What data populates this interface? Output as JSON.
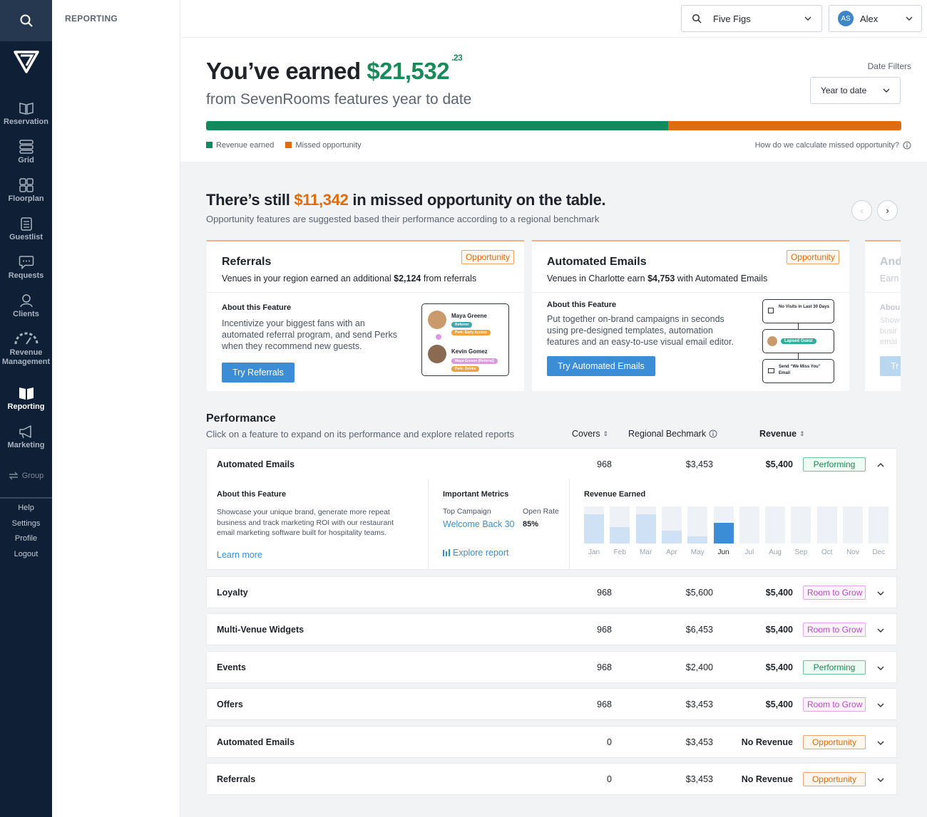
{
  "sidebar": {
    "items": [
      {
        "label": "Reservation",
        "icon": "book-open-icon"
      },
      {
        "label": "Grid",
        "icon": "grid-icon"
      },
      {
        "label": "Floorplan",
        "icon": "floorplan-icon"
      },
      {
        "label": "Guestlist",
        "icon": "clipboard-icon"
      },
      {
        "label": "Requests",
        "icon": "chat-icon"
      },
      {
        "label": "Clients",
        "icon": "user-icon"
      },
      {
        "label": "Revenue Management",
        "icon": "gauge-icon"
      },
      {
        "label": "Reporting",
        "icon": "book-icon"
      },
      {
        "label": "Marketing",
        "icon": "megaphone-icon"
      }
    ],
    "group_label": "Group",
    "bottom_links": [
      "Help",
      "Settings",
      "Profile",
      "Logout"
    ]
  },
  "subnav": {
    "title": "REPORTING"
  },
  "topbar": {
    "venue": "Five Figs",
    "user_initials": "AS",
    "user_name": "Alex"
  },
  "hero": {
    "title_prefix": "You’ve earned ",
    "amount": "$21,532",
    "cents": ".23",
    "subtitle": "from SevenRooms features year to date",
    "date_filters_label": "Date Filters",
    "date_filter_value": "Year to date",
    "earned_fraction": 0.665,
    "legend_earned": "Revenue earned",
    "legend_missed": "Missed opportunity",
    "calc_link": "How do we calculate missed opportunity?"
  },
  "colors": {
    "earned": "#108a5e",
    "missed": "#e06c0e",
    "accent_blue": "#3b8ed6",
    "sidebar_bg": "#0f1f35"
  },
  "opportunity": {
    "title_prefix": "There’s still ",
    "amount": "$11,342",
    "title_suffix": " in missed opportunity on the table.",
    "subtitle": "Opportunity features are suggested based their performance according to a regional benchmark",
    "cards": [
      {
        "title": "Referrals",
        "badge": "Opportunity",
        "desc_prefix": "Venues in your region earned an additional ",
        "desc_amount": "$2,124",
        "desc_suffix": " from referrals",
        "about_label": "About this Feature",
        "about_text": "Incentivize your biggest fans with an automated referral program, and send Perks when they recommend new guests.",
        "button": "Try Referrals",
        "mock": {
          "person1": "Maya Greene",
          "person1_tags": [
            "Referrer",
            "Perk: Early Access"
          ],
          "person2": "Kevin Gomez",
          "person2_tags": [
            "Maya Greene (Referral)",
            "Perk: Drinks"
          ]
        }
      },
      {
        "title": "Automated Emails",
        "badge": "Opportunity",
        "desc_prefix": "Venues in Charlotte earn ",
        "desc_amount": "$4,753",
        "desc_suffix": " with Automated Emails",
        "about_label": "About this Feature",
        "about_text": "Put together on-brand campaigns in seconds using pre-designed templates, automation features and an easy-to-use visual email editor.",
        "button": "Try Automated Emails",
        "mock": {
          "step1": "No Visits in Last 30 Days",
          "step2": "Lapsed Guest",
          "step3": "Send “We Miss You” Email"
        }
      },
      {
        "title": "And",
        "subtitle": "Earn",
        "about_label": "Abou",
        "about_lines": [
          "Show",
          "busir",
          "emai"
        ],
        "button": "Tr"
      }
    ]
  },
  "performance": {
    "title": "Performance",
    "subtitle": "Click on a feature to expand on its performance and explore related reports",
    "columns": {
      "covers": "Covers",
      "benchmark": "Regional Bechmark",
      "revenue": "Revenue"
    },
    "expanded": {
      "about_label": "About this Feature",
      "about_text": "Showcase your unique brand, generate more repeat business and track marketing ROI with our restaurant email marketing software built for hospitality teams.",
      "learn_more": "Learn more",
      "metrics_label": "Important Metrics",
      "top_campaign_label": "Top Campaign",
      "top_campaign_value": "Welcome Back 30",
      "open_rate_label": "Open Rate",
      "open_rate_value": "85%",
      "explore": "Explore report",
      "revenue_label": "Revenue Earned",
      "months": [
        "Jan",
        "Feb",
        "Mar",
        "Apr",
        "May",
        "Jun",
        "Jul",
        "Aug",
        "Sep",
        "Oct",
        "Nov",
        "Dec"
      ],
      "current_month_index": 5,
      "month_fill_fraction": [
        0.78,
        0.44,
        0.78,
        0.35,
        0.19,
        0.56,
        0,
        0,
        0,
        0,
        0,
        0
      ]
    },
    "rows": [
      {
        "name": "Automated Emails",
        "covers": "968",
        "benchmark": "$3,453",
        "revenue": "$5,400",
        "status": "Performing",
        "status_type": "perf",
        "expanded": true
      },
      {
        "name": "Loyalty",
        "covers": "968",
        "benchmark": "$5,600",
        "revenue": "$5,400",
        "status": "Room to Grow",
        "status_type": "grow"
      },
      {
        "name": "Multi-Venue Widgets",
        "covers": "968",
        "benchmark": "$6,453",
        "revenue": "$5,400",
        "status": "Room to Grow",
        "status_type": "grow"
      },
      {
        "name": "Events",
        "covers": "968",
        "benchmark": "$2,400",
        "revenue": "$5,400",
        "status": "Performing",
        "status_type": "perf"
      },
      {
        "name": "Offers",
        "covers": "968",
        "benchmark": "$3,453",
        "revenue": "$5,400",
        "status": "Room to Grow",
        "status_type": "grow"
      },
      {
        "name": "Automated Emails",
        "covers": "0",
        "benchmark": "$3,453",
        "revenue": "No Revenue",
        "status": "Opportunity",
        "status_type": "opp"
      },
      {
        "name": "Referrals",
        "covers": "0",
        "benchmark": "$3,453",
        "revenue": "No Revenue",
        "status": "Opportunity",
        "status_type": "opp"
      }
    ]
  }
}
